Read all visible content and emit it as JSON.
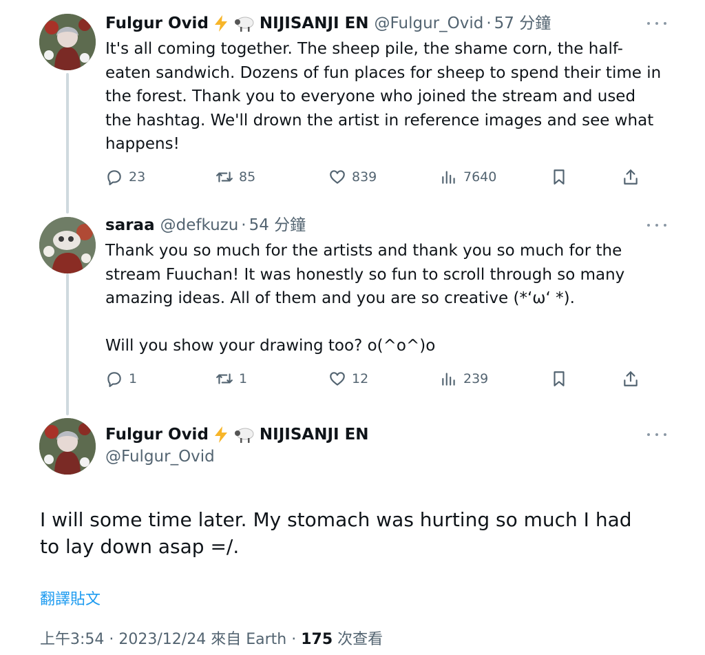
{
  "tweets": [
    {
      "name": "Fulgur Ovid",
      "org": "NIJISANJI EN",
      "handle": "@Fulgur_Ovid",
      "sep": "·",
      "time": "57 分鐘",
      "text": "It's all coming together. The sheep pile, the shame corn, the half-eaten sandwich. Dozens of fun places for sheep to spend their time in the forest. Thank you to everyone who joined the stream and used the hashtag. We'll drown the artist in reference images and see what happens!",
      "stats": {
        "replies": "23",
        "retweets": "85",
        "likes": "839",
        "views": "7640"
      }
    },
    {
      "name": "saraa",
      "handle": "@defkuzu",
      "sep": "·",
      "time": "54 分鐘",
      "text": "Thank you so much for the artists and thank you so much for the stream Fuuchan! It was honestly so fun to scroll through so many amazing ideas. All of them and you are so creative (*‘ω‘ *).\n\nWill you show your drawing too? o(^o^)o",
      "stats": {
        "replies": "1",
        "retweets": "1",
        "likes": "12",
        "views": "239"
      }
    }
  ],
  "main": {
    "name": "Fulgur Ovid",
    "org": "NIJISANJI EN",
    "handle": "@Fulgur_Ovid",
    "text": "I will some time later. My stomach was hurting so much I had to lay down asap =/.",
    "translate": "翻譯貼文",
    "time": "上午3:54",
    "sep1": "·",
    "date": "2023/12/24",
    "source": "來自 Earth",
    "sep2": "·",
    "views": "175",
    "views_label": "次查看"
  },
  "icons": {
    "emoji_1": "lightning-icon",
    "emoji_2": "sheep-icon",
    "reply": "reply-icon",
    "retweet": "retweet-icon",
    "like": "heart-icon",
    "views": "analytics-icon",
    "bookmark": "bookmark-icon",
    "share": "share-icon",
    "more": "more-icon"
  },
  "colors": {
    "accent": "#1d9bf0",
    "muted": "#536471",
    "text": "#0f1419",
    "thread": "#cfd9de"
  }
}
